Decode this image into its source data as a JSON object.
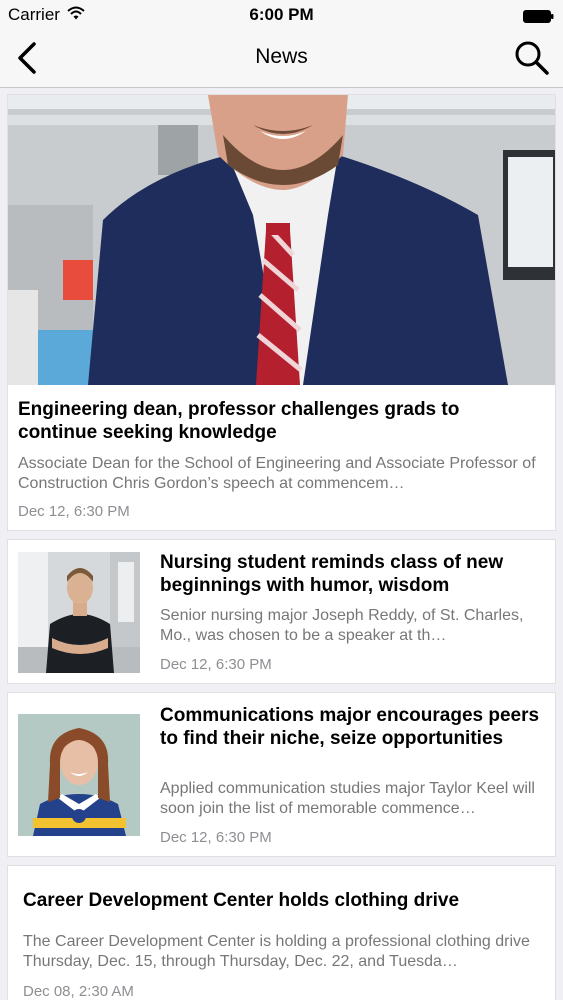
{
  "status_bar": {
    "carrier": "Carrier",
    "time": "6:00 PM"
  },
  "nav": {
    "title": "News",
    "back_icon": "chevron-left-icon",
    "search_icon": "search-icon"
  },
  "colors": {
    "background": "#efeff4",
    "card": "#ffffff",
    "headline": "#000000",
    "summary": "#777777",
    "date": "#8e8e93"
  },
  "articles": [
    {
      "headline": "Engineering dean, professor challenges grads to continue seeking knowledge",
      "summary": "Associate Dean for the School of Engineering and Associate Professor of Construction Chris Gordon’s speech at commencem…",
      "date": "Dec 12, 6:30 PM",
      "image": "photo of man in navy suit with red striped tie"
    },
    {
      "headline": "Nursing student reminds class of new beginnings with humor, wisdom",
      "summary": "Senior nursing major Joseph Reddy, of St. Charles, Mo., was chosen to be a speaker at th…",
      "date": "Dec 12, 6:30 PM",
      "image": "photo of man in dark scrubs with arms crossed"
    },
    {
      "headline": "Communications major encourages peers  to find their niche, seize opportunities",
      "summary": "Applied communication studies major Taylor Keel will soon join the list of memorable commence…",
      "date": "Dec 12, 6:30 PM",
      "image": "photo of smiling woman in blue hockey jersey"
    },
    {
      "headline": "Career Development Center holds  clothing drive",
      "summary": "The Career Development Center is holding a professional clothing drive Thursday, Dec. 15, through Thursday, Dec. 22, and Tuesda…",
      "date": "Dec 08, 2:30 AM"
    }
  ]
}
